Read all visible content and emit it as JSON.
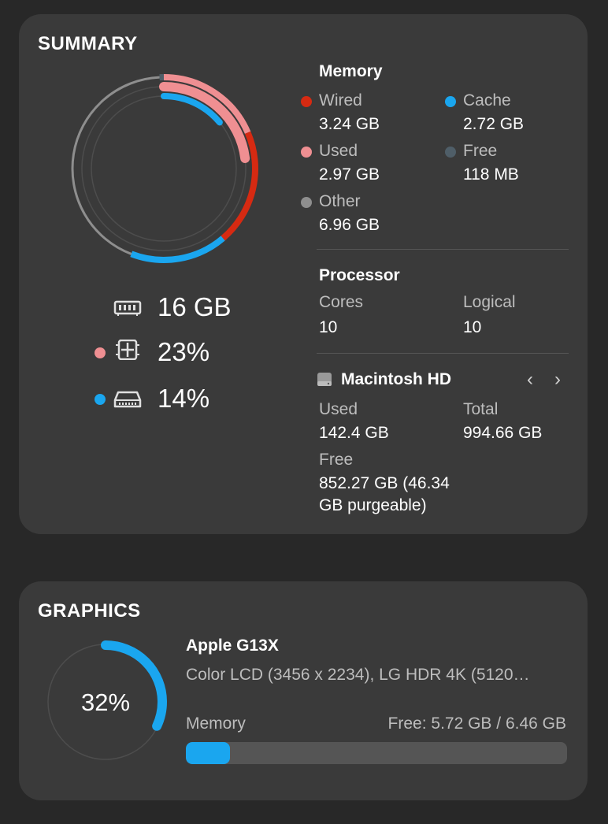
{
  "colors": {
    "wired": "#d62a12",
    "used": "#ef8f92",
    "cache": "#1aa6ef",
    "free": "#4f5e68",
    "other": "#8e8e8e",
    "ring_track": "#4d4d4d"
  },
  "summary": {
    "title": "SUMMARY",
    "ring": {
      "memory_total_gb": 16,
      "wired_gb": 3.24,
      "used_gb": 2.97,
      "cache_gb": 2.72,
      "other_gb": 6.96,
      "free_gb": 0.118,
      "cpu_percent": 23,
      "disk_percent": 14
    },
    "stats": {
      "memory_icon": "ram-icon",
      "memory_value": "16 GB",
      "cpu_icon": "cpu-chip-icon",
      "cpu_value": "23%",
      "disk_icon": "drive-icon",
      "disk_value": "14%"
    },
    "memory": {
      "title": "Memory",
      "wired_label": "Wired",
      "wired_value": "3.24 GB",
      "cache_label": "Cache",
      "cache_value": "2.72 GB",
      "used_label": "Used",
      "used_value": "2.97 GB",
      "free_label": "Free",
      "free_value": "118 MB",
      "other_label": "Other",
      "other_value": "6.96 GB"
    },
    "processor": {
      "title": "Processor",
      "cores_label": "Cores",
      "cores_value": "10",
      "logical_label": "Logical",
      "logical_value": "10"
    },
    "disk": {
      "icon": "hard-drive-icon",
      "title": "Macintosh HD",
      "used_label": "Used",
      "used_value": "142.4 GB",
      "total_label": "Total",
      "total_value": "994.66 GB",
      "free_label": "Free",
      "free_value_line1": "852.27 GB (46.34",
      "free_value_line2": "GB purgeable)",
      "prev_icon": "chevron-left-icon",
      "next_icon": "chevron-right-icon"
    }
  },
  "graphics": {
    "title": "GRAPHICS",
    "usage_percent": 32,
    "usage_label": "32%",
    "gpu_name": "Apple G13X",
    "displays": "Color LCD (3456 x 2234), LG HDR 4K (5120…",
    "memory_label": "Memory",
    "memory_free": "Free: 5.72 GB / 6.46 GB",
    "memory_used_fraction": 0.115
  }
}
